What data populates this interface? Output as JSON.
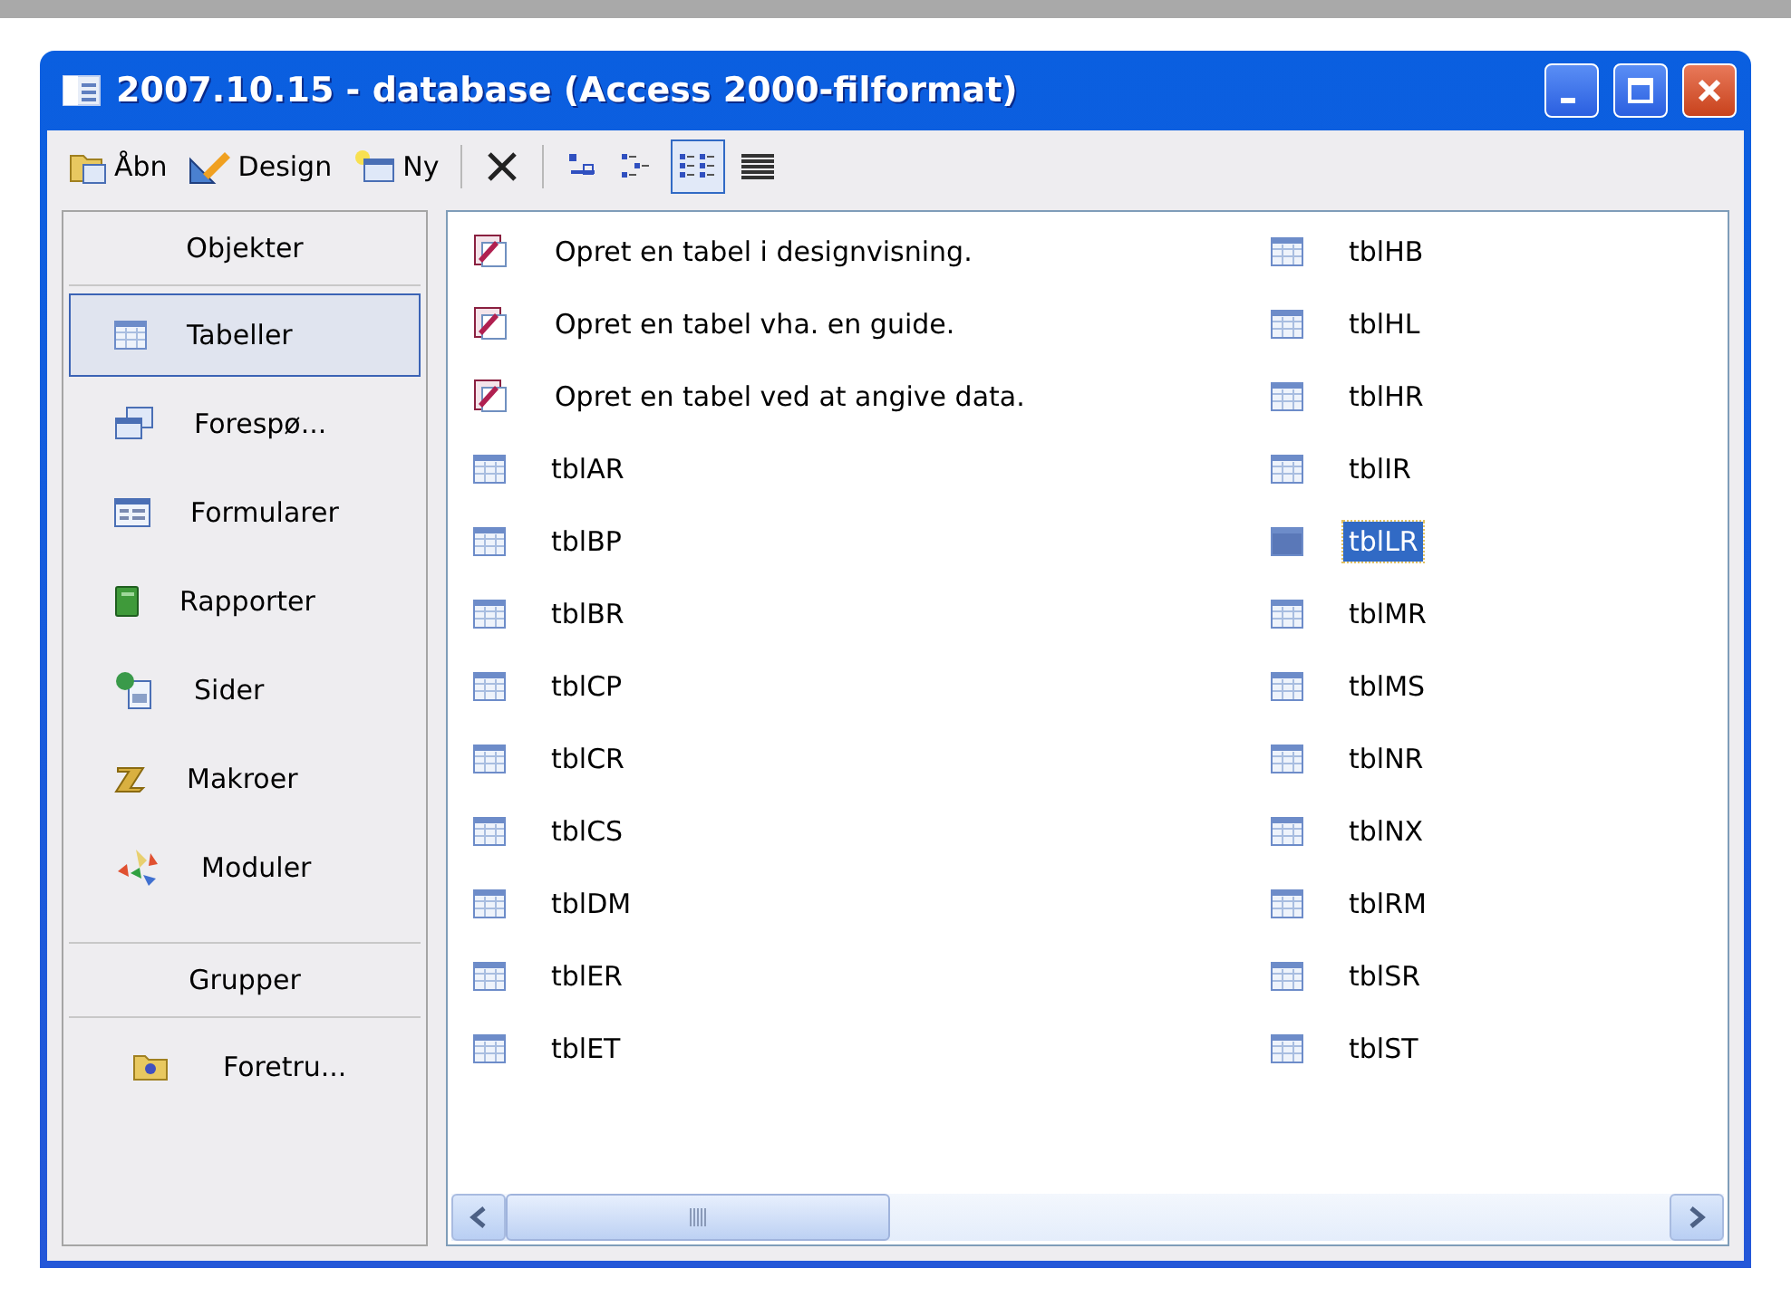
{
  "window": {
    "title": "2007.10.15 - database (Access 2000-filformat)"
  },
  "toolbar": {
    "buttons": [
      {
        "kind": "open",
        "label": "Åbn"
      },
      {
        "kind": "design",
        "label": "Design"
      },
      {
        "kind": "new",
        "label": "Ny"
      },
      {
        "kind": "delete"
      }
    ],
    "views": [
      {
        "kind": "large",
        "selected": false
      },
      {
        "kind": "small",
        "selected": false
      },
      {
        "kind": "list",
        "selected": true
      },
      {
        "kind": "details",
        "selected": false
      }
    ]
  },
  "sidebar": {
    "objects_header": "Objekter",
    "items": [
      {
        "kind": "tables",
        "label": "Tabeller",
        "selected": true
      },
      {
        "kind": "queries",
        "label": "Forespø...",
        "selected": false
      },
      {
        "kind": "forms",
        "label": "Formularer",
        "selected": false
      },
      {
        "kind": "reports",
        "label": "Rapporter",
        "selected": false
      },
      {
        "kind": "pages",
        "label": "Sider",
        "selected": false
      },
      {
        "kind": "macros",
        "label": "Makroer",
        "selected": false
      },
      {
        "kind": "modules",
        "label": "Moduler",
        "selected": false
      }
    ],
    "groups_header": "Grupper",
    "groups": [
      {
        "label": "Foretru...",
        "selected": false
      }
    ]
  },
  "list": {
    "items": [
      {
        "kind": "wizard",
        "label": "Opret en tabel i designvisning.",
        "selected": false
      },
      {
        "kind": "wizard",
        "label": "Opret en tabel vha. en guide.",
        "selected": false
      },
      {
        "kind": "wizard",
        "label": "Opret en tabel ved at angive data.",
        "selected": false
      },
      {
        "kind": "table",
        "label": "tblAR",
        "selected": false
      },
      {
        "kind": "table",
        "label": "tblBP",
        "selected": false
      },
      {
        "kind": "table",
        "label": "tblBR",
        "selected": false
      },
      {
        "kind": "table",
        "label": "tblCP",
        "selected": false
      },
      {
        "kind": "table",
        "label": "tblCR",
        "selected": false
      },
      {
        "kind": "table",
        "label": "tblCS",
        "selected": false
      },
      {
        "kind": "table",
        "label": "tblDM",
        "selected": false
      },
      {
        "kind": "table",
        "label": "tblER",
        "selected": false
      },
      {
        "kind": "table",
        "label": "tblET",
        "selected": false
      },
      {
        "kind": "table",
        "label": "tblHB",
        "selected": false
      },
      {
        "kind": "table",
        "label": "tblHL",
        "selected": false
      },
      {
        "kind": "table",
        "label": "tblHR",
        "selected": false
      },
      {
        "kind": "table",
        "label": "tblIR",
        "selected": false
      },
      {
        "kind": "table",
        "label": "tblLR",
        "selected": true
      },
      {
        "kind": "table",
        "label": "tblMR",
        "selected": false
      },
      {
        "kind": "table",
        "label": "tblMS",
        "selected": false
      },
      {
        "kind": "table",
        "label": "tblNR",
        "selected": false
      },
      {
        "kind": "table",
        "label": "tblNX",
        "selected": false
      },
      {
        "kind": "table",
        "label": "tblRM",
        "selected": false
      },
      {
        "kind": "table",
        "label": "tblSR",
        "selected": false
      },
      {
        "kind": "table",
        "label": "tblST",
        "selected": false
      }
    ]
  }
}
